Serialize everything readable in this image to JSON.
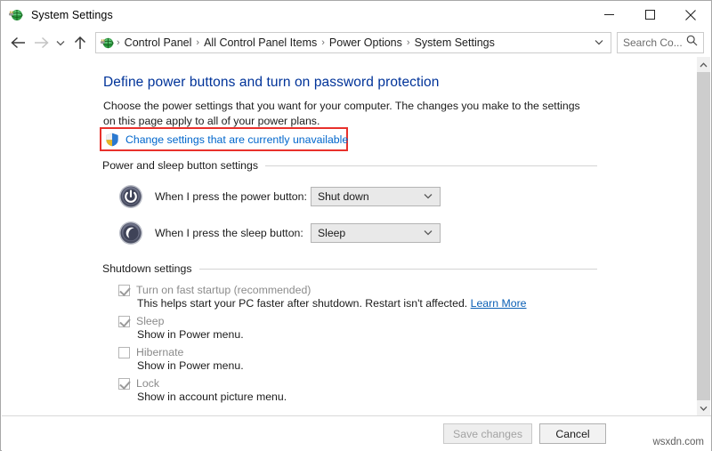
{
  "window": {
    "title": "System Settings",
    "icon": "control-panel-icon",
    "controls": {
      "minimize": "minimize-icon",
      "maximize": "maximize-icon",
      "close": "close-icon"
    }
  },
  "addressbar": {
    "back": "back-arrow-icon",
    "forward": "forward-arrow-icon",
    "recent": "chevron-down-icon",
    "up": "up-arrow-icon",
    "breadcrumbs": [
      "Control Panel",
      "All Control Panel Items",
      "Power Options",
      "System Settings"
    ],
    "separator": "›",
    "dropdown": "chevron-down-icon",
    "refresh": "refresh-icon",
    "search": {
      "placeholder": "Search Co...",
      "icon": "search-icon"
    }
  },
  "main": {
    "heading": "Define power buttons and turn on password protection",
    "intro": "Choose the power settings that you want for your computer. The changes you make to the settings on this page apply to all of your power plans.",
    "uac_link": {
      "label": "Change settings that are currently unavailable",
      "icon": "uac-shield-icon",
      "highlight_color": "#e8312c"
    },
    "groups": [
      {
        "title": "Power and sleep button settings",
        "rows": [
          {
            "icon": "power-button-icon",
            "label": "When I press the power button:",
            "value": "Shut down",
            "enabled": false
          },
          {
            "icon": "sleep-moon-icon",
            "label": "When I press the sleep button:",
            "value": "Sleep",
            "enabled": false
          }
        ]
      },
      {
        "title": "Shutdown settings",
        "checkboxes": [
          {
            "label": "Turn on fast startup (recommended)",
            "checked": true,
            "enabled": false,
            "description": "This helps start your PC faster after shutdown. Restart isn't affected.",
            "link": "Learn More"
          },
          {
            "label": "Sleep",
            "checked": true,
            "enabled": false,
            "description": "Show in Power menu.",
            "link": ""
          },
          {
            "label": "Hibernate",
            "checked": false,
            "enabled": false,
            "description": "Show in Power menu.",
            "link": ""
          },
          {
            "label": "Lock",
            "checked": true,
            "enabled": false,
            "description": "Show in account picture menu.",
            "link": ""
          }
        ]
      }
    ]
  },
  "footer": {
    "save_label": "Save changes",
    "cancel_label": "Cancel",
    "watermark": "wsxdn.com"
  },
  "colors": {
    "heading": "#003399",
    "link": "#0066cc",
    "highlight": "#e8312c",
    "disabled_text": "#8b8b8b"
  }
}
